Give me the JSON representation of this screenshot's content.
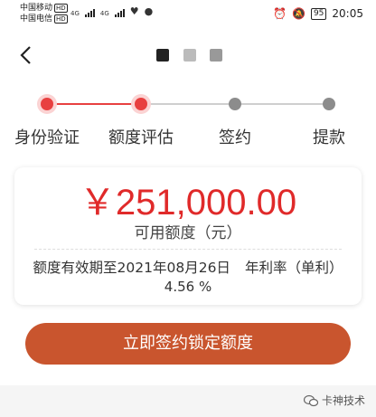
{
  "status_bar": {
    "carrier1": "中国移动",
    "carrier2": "中国电信",
    "hd": "HD",
    "net1": "4G",
    "net2": "4G",
    "battery": "95",
    "time": "20:05"
  },
  "steps": [
    {
      "label": "身份验证",
      "state": "done"
    },
    {
      "label": "额度评估",
      "state": "done"
    },
    {
      "label": "签约",
      "state": "pending"
    },
    {
      "label": "提款",
      "state": "pending"
    }
  ],
  "amount": "￥251,000.00",
  "amount_label": "可用额度（元）",
  "validity": "额度有效期至2021年08月26日",
  "rate_label": "年利率（单利）",
  "rate_value": "4.56 %",
  "primary_button": "立即签约锁定额度",
  "watermark": "卡神技术",
  "colors": {
    "accent": "#e84040",
    "button": "#c9552e",
    "amount": "#e02a2a"
  }
}
